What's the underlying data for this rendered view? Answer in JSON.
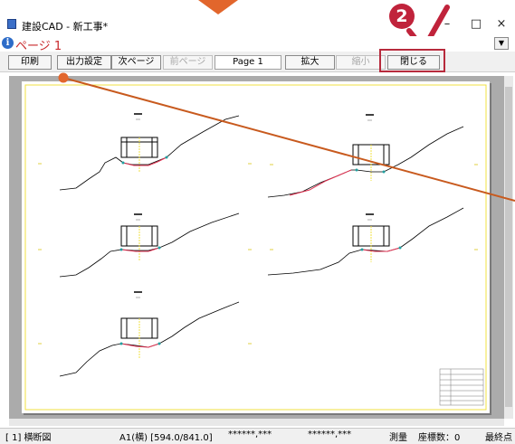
{
  "window": {
    "title": "建設CAD - 新工事*",
    "minimize": "–",
    "maximize": "□",
    "close": "×"
  },
  "annotation": {
    "step_number": "2",
    "accent_color": "#c0233b",
    "arrow_color": "#e2662c"
  },
  "pagebar": {
    "label": "ページ 1",
    "dropdown": "▼"
  },
  "toolbar": {
    "print": "印刷",
    "output_settings": "出力設定",
    "next_page": "次ページ",
    "prev_page": "前ページ",
    "page": "Page 1",
    "zoom_in": "拡大",
    "zoom_out": "縮小",
    "close": "閉じる"
  },
  "status": {
    "layer": "[ 1] 横断図",
    "paper": "A1(横) [594.0/841.0]",
    "coord1": "******,***",
    "coord2": "******,***",
    "mode": "測量",
    "coord_count": "座標数：0",
    "last": "最終点"
  }
}
